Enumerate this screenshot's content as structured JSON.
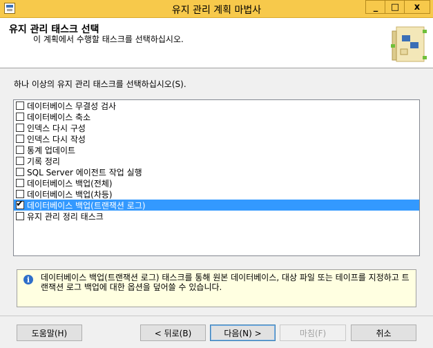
{
  "window": {
    "title": "유지 관리 계획 마법사",
    "min_label": "_",
    "max_label": "□",
    "close_label": "x"
  },
  "header": {
    "title": "유지 관리 태스크 선택",
    "subtitle": "이 계획에서 수행할 태스크를 선택하십시오."
  },
  "prompt": "하나 이상의 유지 관리 태스크를 선택하십시오(S).",
  "tasks": [
    {
      "label": "데이터베이스 무결성 검사",
      "checked": false,
      "selected": false
    },
    {
      "label": "데이터베이스 축소",
      "checked": false,
      "selected": false
    },
    {
      "label": "인덱스 다시 구성",
      "checked": false,
      "selected": false
    },
    {
      "label": "인덱스 다시 작성",
      "checked": false,
      "selected": false
    },
    {
      "label": "통계 업데이트",
      "checked": false,
      "selected": false
    },
    {
      "label": "기록 정리",
      "checked": false,
      "selected": false
    },
    {
      "label": "SQL Server 에이전트 작업 실행",
      "checked": false,
      "selected": false
    },
    {
      "label": "데이터베이스 백업(전체)",
      "checked": false,
      "selected": false
    },
    {
      "label": "데이터베이스 백업(차등)",
      "checked": false,
      "selected": false
    },
    {
      "label": "데이터베이스 백업(트랜잭션 로그)",
      "checked": true,
      "selected": true
    },
    {
      "label": "유지 관리 정리 태스크",
      "checked": false,
      "selected": false
    }
  ],
  "info": {
    "text": "데이터베이스 백업(트랜잭션 로그) 태스크를 통해 원본 데이터베이스, 대상 파일 또는 테이프를 지정하고 트랜잭션 로그 백업에 대한 옵션을 덮어쓸 수 있습니다."
  },
  "buttons": {
    "help": "도움말(H)",
    "back": "< 뒤로(B)",
    "next": "다음(N) >",
    "finish": "마침(F)",
    "cancel": "취소"
  },
  "colors": {
    "titlebar": "#f7c94b",
    "selection": "#3399ff",
    "info_background": "#ffffe1"
  }
}
